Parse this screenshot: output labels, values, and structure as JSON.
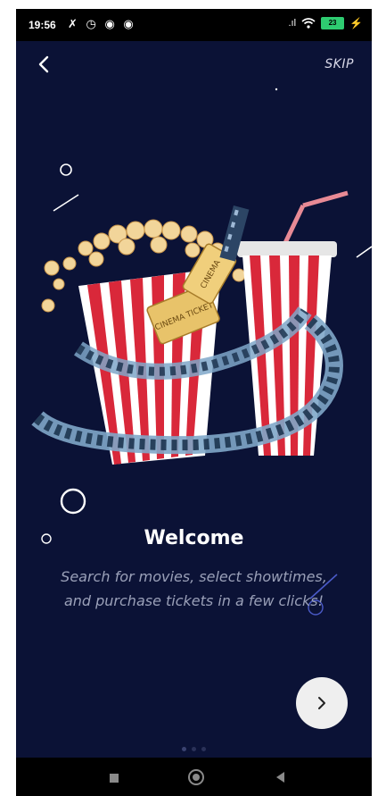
{
  "status_bar": {
    "time": "19:56",
    "battery": "23"
  },
  "header": {
    "back_icon": "chevron-left-icon",
    "skip_label": "SKIP"
  },
  "illustration": {
    "name": "popcorn-soda-ticket-illustration",
    "ticket_text_1": "CINEMA",
    "ticket_text_2": "CINEMA TICKET"
  },
  "content": {
    "title": "Welcome",
    "subtitle": "Search for movies, select showtimes, and purchase tickets in a few clicks!"
  },
  "next_button": {
    "icon": "chevron-right-icon"
  },
  "pager": {
    "total": 3,
    "active": 0
  },
  "colors": {
    "background": "#0b1236",
    "accent_red": "#d9283a",
    "text_muted": "#9aa0b8"
  },
  "system_nav": {
    "recent_icon": "square-icon",
    "home_icon": "circle-icon",
    "back_icon": "triangle-left-icon"
  }
}
